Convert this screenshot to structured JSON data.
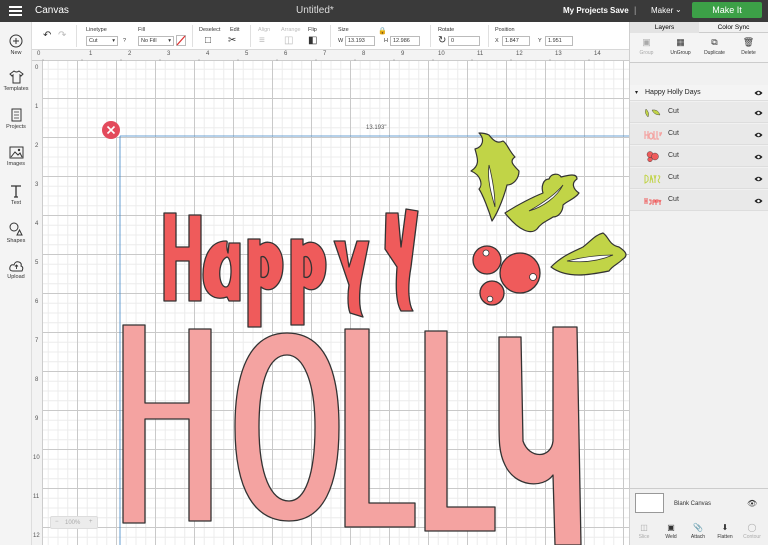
{
  "topbar": {
    "app_name": "Canvas",
    "document_title": "Untitled*",
    "my_projects": "My Projects",
    "save": "Save",
    "separator": "|",
    "machine": "Maker",
    "make_it": "Make It"
  },
  "left_nav": {
    "items": [
      {
        "label": "New",
        "icon": "plus-circle-icon"
      },
      {
        "label": "Templates",
        "icon": "shirt-icon"
      },
      {
        "label": "Projects",
        "icon": "book-icon"
      },
      {
        "label": "Images",
        "icon": "image-icon"
      },
      {
        "label": "Text",
        "icon": "text-icon"
      },
      {
        "label": "Shapes",
        "icon": "shapes-icon"
      },
      {
        "label": "Upload",
        "icon": "upload-cloud-icon"
      }
    ]
  },
  "toolbar": {
    "linetype_label": "Linetype",
    "linetype_value": "Cut",
    "help_mark": "?",
    "fill_label": "Fill",
    "fill_value": "No Fill",
    "deselect_label": "Deselect",
    "edit_label": "Edit",
    "align_label": "Align",
    "arrange_label": "Arrange",
    "flip_label": "Flip",
    "size_label": "Size",
    "size_w_label": "W",
    "size_w_value": "13.193",
    "size_h_label": "H",
    "size_h_value": "12.986",
    "rotate_label": "Rotate",
    "rotate_value": "0",
    "position_label": "Position",
    "position_x_label": "X",
    "position_x_value": "1.847",
    "position_y_label": "Y",
    "position_y_value": "1.951"
  },
  "rulers": {
    "top_ticks": [
      "0",
      "1",
      "2",
      "3",
      "4",
      "5",
      "6",
      "7",
      "8",
      "9",
      "10",
      "11",
      "12",
      "13",
      "14"
    ],
    "left_ticks": [
      "0",
      "1",
      "2",
      "3",
      "4",
      "5",
      "6",
      "7",
      "8",
      "9",
      "10",
      "11",
      "12"
    ]
  },
  "canvas": {
    "width_readout": "13.193\"",
    "zoom": "100%",
    "colors": {
      "red": "#ef5b5b",
      "pink": "#f4a3a1",
      "green": "#c1d447",
      "outline": "#333333",
      "selection": "#3d84c6",
      "delete": "#e34a5c"
    }
  },
  "right_panel": {
    "tabs": [
      "Layers",
      "Color Sync"
    ],
    "tools": [
      {
        "label": "Group",
        "icon": "group-icon",
        "enabled": false
      },
      {
        "label": "UnGroup",
        "icon": "ungroup-icon",
        "enabled": true
      },
      {
        "label": "Duplicate",
        "icon": "duplicate-icon",
        "enabled": true
      },
      {
        "label": "Delete",
        "icon": "trash-icon",
        "enabled": true
      }
    ],
    "group_name": "Happy Holly Days",
    "layers": [
      {
        "label": "Cut",
        "thumb": "leaf",
        "color": "#c1d447"
      },
      {
        "label": "Cut",
        "thumb": "holly-text",
        "color": "#f4a3a1"
      },
      {
        "label": "Cut",
        "thumb": "berries",
        "color": "#ef5b5b"
      },
      {
        "label": "Cut",
        "thumb": "days-text",
        "color": "#c1d447"
      },
      {
        "label": "Cut",
        "thumb": "happy-text",
        "color": "#ef5b5b"
      }
    ],
    "blank_canvas": "Blank Canvas",
    "bottom_tools": [
      {
        "label": "Slice",
        "icon": "slice-icon",
        "enabled": false
      },
      {
        "label": "Weld",
        "icon": "weld-icon",
        "enabled": true
      },
      {
        "label": "Attach",
        "icon": "attach-icon",
        "enabled": true
      },
      {
        "label": "Flatten",
        "icon": "flatten-icon",
        "enabled": true
      },
      {
        "label": "Contour",
        "icon": "contour-icon",
        "enabled": false
      }
    ]
  }
}
